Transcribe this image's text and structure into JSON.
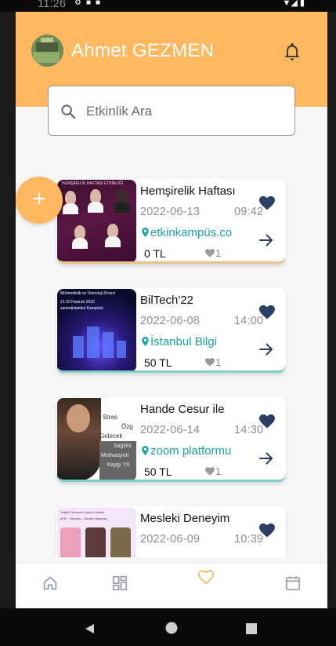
{
  "status_bar": {
    "time": "11:26"
  },
  "header": {
    "username": "Ahmet GEZMEN"
  },
  "search": {
    "placeholder": "Etkinlik Ara"
  },
  "fab": {
    "label": "+"
  },
  "events": [
    {
      "title": "Hemşirelik Haftası",
      "date": "2022-06-13",
      "time": "09:42",
      "location": "etkinkampüs.co",
      "price": "0 TL",
      "likes": "1",
      "favorited": true,
      "card_accent": "#e9c48a"
    },
    {
      "title": "BilTech'22",
      "date": "2022-06-08",
      "time": "14:00",
      "location": "İstanbul Bilgi",
      "price": "50 TL",
      "likes": "1",
      "favorited": true,
      "card_accent": "#7ecfc7"
    },
    {
      "title": "Hande Cesur ile",
      "date": "2022-06-14",
      "time": "14:30",
      "location": "zoom platformu",
      "price": "50 TL",
      "likes": "1",
      "favorited": true,
      "card_accent": "#7ecfc7"
    },
    {
      "title": "Mesleki Deneyim",
      "date": "2022-06-09",
      "time": "10:39",
      "location": "",
      "price": "",
      "likes": "",
      "favorited": true,
      "card_accent": "#ffffff"
    }
  ],
  "thumbnails": {
    "event_0": {
      "title": "HEMŞİRELİK HAFTASI ETKİNLİĞİ"
    },
    "event_1": {
      "title": "Mühendislik ve Teknoloji Zirvesi",
      "date_tag": "21-22 Haziran 2022",
      "venue": "santralistanbul Kampüsü"
    },
    "event_2": {
      "line1": "Stres",
      "line2": "Özg",
      "line3": "Gelecek",
      "line4": "Sağlıklı",
      "line5": "Motivasyon",
      "line6": "Kaygı Yö"
    },
    "event_3": {
      "title": "Sağlık Personeli Lisansı Olarak",
      "subtitle": "aPel - Yazvaye - Dezelin Aktavası"
    }
  },
  "bottom_nav": [
    "home-icon",
    "dashboard-icon",
    "heart-outline-icon",
    "calendar-icon"
  ],
  "colors": {
    "accent": "#ffb85f",
    "teal": "#1aa3a0",
    "navy": "#2c3e66",
    "active_tab": "#ffb85f"
  }
}
